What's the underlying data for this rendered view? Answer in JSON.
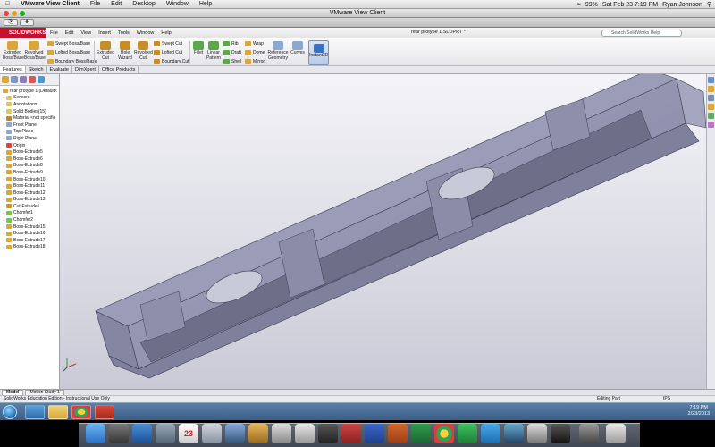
{
  "mac_menubar": {
    "apple_icon": "apple-icon",
    "items": [
      "VMware View Client",
      "File",
      "Edit",
      "Desktop",
      "Window",
      "Help"
    ],
    "battery": "99%",
    "clock": "Sat Feb 23  7:19 PM",
    "user": "Ryan Johnson"
  },
  "vmware": {
    "title": "VMware View Client"
  },
  "solidworks": {
    "logo": "SOLIDWORKS",
    "menu": [
      "File",
      "Edit",
      "View",
      "Insert",
      "Tools",
      "Window",
      "Help"
    ],
    "doc_title": "rear protype 1.SLDPRT *",
    "search_placeholder": "Search SolidWorks Help"
  },
  "commands": {
    "extruded_boss": "Extruded Boss/Base",
    "revolved_boss": "Revolved Boss/Base",
    "swept_boss": "Swept Boss/Base",
    "lofted_boss": "Lofted Boss/Base",
    "boundary_boss": "Boundary Boss/Base",
    "extruded_cut": "Extruded Cut",
    "hole_wizard": "Hole Wizard",
    "revolved_cut": "Revolved Cut",
    "swept_cut": "Swept Cut",
    "lofted_cut": "Lofted Cut",
    "boundary_cut": "Boundary Cut",
    "fillet": "Fillet",
    "linear_pattern": "Linear Pattern",
    "rib": "Rib",
    "draft": "Draft",
    "shell": "Shell",
    "wrap": "Wrap",
    "dome": "Dome",
    "mirror": "Mirror",
    "reference_geometry": "Reference Geometry",
    "curves": "Curves",
    "instant3d": "Instant3D"
  },
  "tabs": [
    "Features",
    "Sketch",
    "Evaluate",
    "DimXpert",
    "Office Products"
  ],
  "tree": {
    "root": "rear protype 1  (Default<",
    "items": [
      {
        "label": "Sensors",
        "icon": "folder"
      },
      {
        "label": "Annotations",
        "icon": "folder"
      },
      {
        "label": "Solid Bodies(15)",
        "icon": "folder"
      },
      {
        "label": "Material <not specifie",
        "icon": "mat"
      },
      {
        "label": "Front Plane",
        "icon": "plane"
      },
      {
        "label": "Top Plane",
        "icon": "plane"
      },
      {
        "label": "Right Plane",
        "icon": "plane"
      },
      {
        "label": "Origin",
        "icon": "orig"
      },
      {
        "label": "Boss-Extrude5",
        "icon": "ext"
      },
      {
        "label": "Boss-Extrude6",
        "icon": "ext"
      },
      {
        "label": "Boss-Extrude8",
        "icon": "ext"
      },
      {
        "label": "Boss-Extrude9",
        "icon": "ext"
      },
      {
        "label": "Boss-Extrude10",
        "icon": "ext"
      },
      {
        "label": "Boss-Extrude11",
        "icon": "ext"
      },
      {
        "label": "Boss-Extrude12",
        "icon": "ext"
      },
      {
        "label": "Boss-Extrude13",
        "icon": "ext"
      },
      {
        "label": "Cut-Extrude1",
        "icon": "cut"
      },
      {
        "label": "Chamfer1",
        "icon": "cham"
      },
      {
        "label": "Chamfer2",
        "icon": "cham"
      },
      {
        "label": "Boss-Extrude15",
        "icon": "ext"
      },
      {
        "label": "Boss-Extrude16",
        "icon": "ext"
      },
      {
        "label": "Boss-Extrude17",
        "icon": "ext"
      },
      {
        "label": "Boss-Extrude18",
        "icon": "ext"
      }
    ]
  },
  "bottom_tabs": [
    "Model",
    "Motion Study 1"
  ],
  "status": {
    "left": "SolidWorks Education Edition - Instructional Use Only",
    "mode": "Editing Part",
    "units": "IPS"
  },
  "taskbar": {
    "time": "7:19 PM",
    "date": "2/23/2013"
  },
  "dock": {
    "calendar_day": "23"
  },
  "colors": {
    "part_face": "#8f91ad",
    "part_light": "#b1b3cb",
    "part_dark": "#5d5f78",
    "viewport_top": "#f4f4f8",
    "viewport_bottom": "#c9cad6"
  }
}
